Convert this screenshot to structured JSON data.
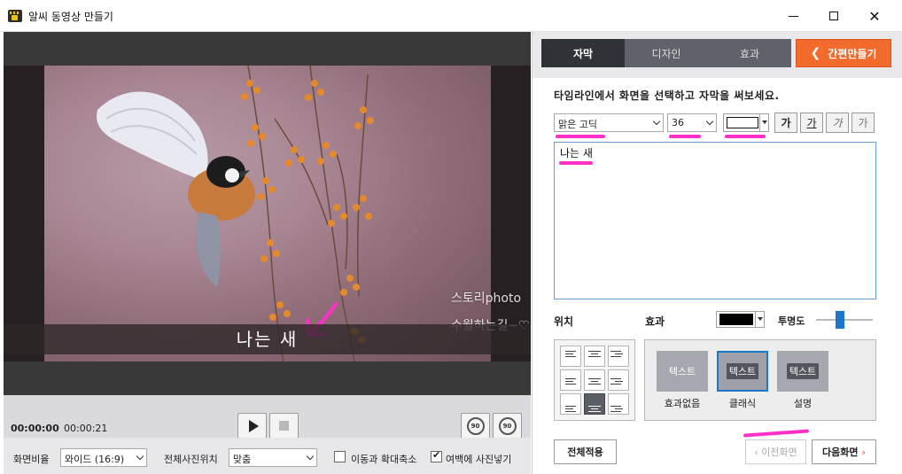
{
  "window": {
    "title": "알씨 동영상 만들기",
    "minimize": "",
    "maximize": "",
    "close": "✕"
  },
  "preview": {
    "subtitle_text": "나는 새",
    "watermark_line1": "스토리photo",
    "watermark_line2": "수월하는길~♡"
  },
  "playback": {
    "current_time": "00:00:00",
    "total_time": "00:00:21",
    "rotate_left_label": "90",
    "rotate_right_label": "90"
  },
  "options": {
    "ratio_label": "화면비율",
    "ratio_value": "와이드 (16:9)",
    "photo_position_label": "전체사진위치",
    "photo_position_value": "맞춤",
    "motion_label": "이동과 확대축소",
    "motion_checked": false,
    "margin_photo_label": "여백에 사진넣기",
    "margin_photo_checked": true
  },
  "tabs": [
    {
      "label": "자막",
      "active": true
    },
    {
      "label": "디자인",
      "active": false
    },
    {
      "label": "효과",
      "active": false
    }
  ],
  "quick_make": {
    "label": "간편만들기",
    "icon": "chevron-left-icon"
  },
  "editor": {
    "instruction": "타임라인에서 화면을 선택하고 자막을 써보세요.",
    "font_value": "맑은 고딕",
    "size_value": "36",
    "text_color": "#ffffff",
    "bold_label": "가",
    "underline_label": "가",
    "italic_label": "가",
    "shadow_label": "가",
    "text_value": "나는 새",
    "position_label": "위치",
    "effect_label": "효과",
    "effect_color": "#000000",
    "opacity_label": "투명도",
    "opacity_value": 0.4,
    "alignment_selected": "bottom-center"
  },
  "effects": [
    {
      "swatch": "텍스트",
      "label": "효과없음",
      "selected": false
    },
    {
      "swatch": "텍스트",
      "label": "클래식",
      "selected": true
    },
    {
      "swatch": "텍스트",
      "label": "설명",
      "selected": false
    }
  ],
  "footer": {
    "apply_all": "전체적용",
    "prev": "‹ 이전화면",
    "next": "다음화면"
  },
  "colors": {
    "accent_orange": "#f26b2c",
    "selection_blue": "#1e76c9",
    "annotation_pink": "#ff2fc8"
  }
}
